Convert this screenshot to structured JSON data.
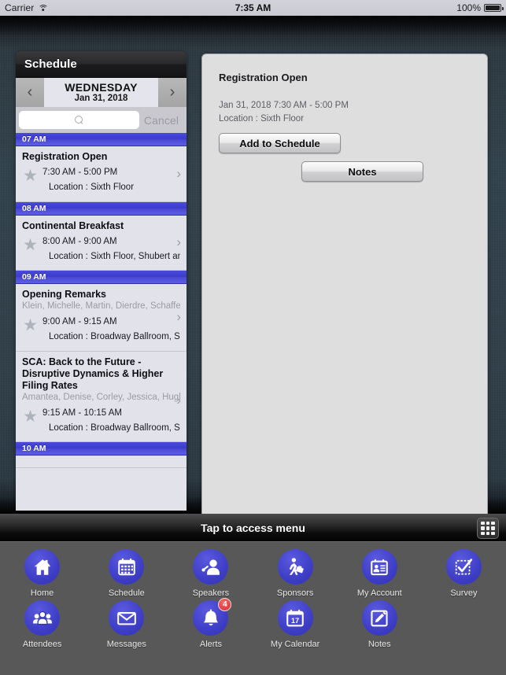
{
  "statusbar": {
    "carrier": "Carrier",
    "wifi_icon": "wifi-icon",
    "time": "7:35 AM",
    "battery_percent": "100%",
    "battery_icon": "battery-full-icon"
  },
  "schedule_panel": {
    "header_title": "Schedule",
    "date_nav": {
      "prev_icon": "chevron-left-icon",
      "next_icon": "chevron-right-icon",
      "day": "WEDNESDAY",
      "date": "Jan 31, 2018"
    },
    "search": {
      "icon": "search-icon",
      "value": "",
      "placeholder": "",
      "cancel_label": "Cancel"
    },
    "groups": [
      {
        "hour": "07 AM",
        "events": [
          {
            "title": "Registration Open",
            "speakers": "",
            "time": "7:30 AM - 5:00 PM",
            "location": "Location : Sixth Floor",
            "star_icon": "star-icon",
            "chevron_icon": "chevron-right-icon"
          }
        ]
      },
      {
        "hour": "08 AM",
        "events": [
          {
            "title": "Continental Breakfast",
            "speakers": "",
            "time": "8:00 AM - 9:00 AM",
            "location": "Location : Sixth Floor, Shubert and Ma",
            "star_icon": "star-icon",
            "chevron_icon": "chevron-right-icon"
          }
        ]
      },
      {
        "hour": "09 AM",
        "events": [
          {
            "title": "Opening Remarks",
            "speakers": "Klein, Michelle, Martin, Dierdre, Schaffel,",
            "time": "9:00 AM - 9:15 AM",
            "location": "Location : Broadway Ballroom, Sixth F",
            "star_icon": "star-icon",
            "chevron_icon": "chevron-right-icon"
          },
          {
            "title": "SCA: Back to the Future - Disruptive Dynamics & Higher Filing Rates",
            "speakers": "Amantea, Denise, Corley, Jessica, Hughes,",
            "time": "9:15 AM - 10:15 AM",
            "location": "Location : Broadway Ballroom, Sixth F",
            "star_icon": "star-icon",
            "chevron_icon": "chevron-right-icon"
          }
        ]
      },
      {
        "hour": "10 AM",
        "events": []
      }
    ]
  },
  "detail_panel": {
    "title": "Registration Open",
    "datetime": "Jan 31, 2018 7:30 AM - 5:00 PM",
    "location": "Location : Sixth Floor",
    "add_button_label": "Add to Schedule",
    "notes_button_label": "Notes"
  },
  "menubar": {
    "text": "Tap to access menu",
    "grid_icon": "grid-icon"
  },
  "drawer": {
    "row1": [
      {
        "label": "Home",
        "icon": "home-icon"
      },
      {
        "label": "Schedule",
        "icon": "calendar-grid-icon"
      },
      {
        "label": "Speakers",
        "icon": "speaker-microphone-icon"
      },
      {
        "label": "Sponsors",
        "icon": "person-briefcase-icon"
      },
      {
        "label": "My Account",
        "icon": "id-card-icon"
      },
      {
        "label": "Survey",
        "icon": "checkbox-check-icon"
      }
    ],
    "row2": [
      {
        "label": "Attendees",
        "icon": "people-group-icon"
      },
      {
        "label": "Messages",
        "icon": "envelope-icon"
      },
      {
        "label": "Alerts",
        "icon": "bell-icon",
        "badge": "4"
      },
      {
        "label": "My Calendar",
        "icon": "calendar-date-icon",
        "calendar_day": "17"
      },
      {
        "label": "Notes",
        "icon": "pencil-square-icon"
      }
    ]
  },
  "colors": {
    "accent_blue": "#4040c8",
    "hour_bar": "#3b3bcc",
    "badge_red": "#d82a2a",
    "denim_bg": "#32424c",
    "list_bg": "#e2e2ea"
  }
}
